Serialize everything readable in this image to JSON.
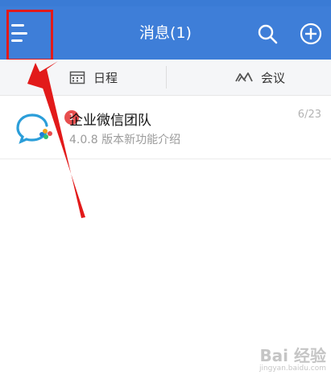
{
  "app_bar": {
    "title": "消息(1)",
    "icons": {
      "menu": "menu-icon",
      "search": "search-icon",
      "add": "add-circle-icon"
    }
  },
  "tabs": [
    {
      "label": "日程",
      "icon": "calendar-icon"
    },
    {
      "label": "会议",
      "icon": "meeting-icon"
    }
  ],
  "messages": [
    {
      "title": "企业微信团队",
      "subtitle": "4.0.8 版本新功能介绍",
      "date": "6/23",
      "badge": "1",
      "icon": "wecom-logo-icon"
    }
  ],
  "watermark": {
    "text": "Bai 经验",
    "url_text": "jingyan.baidu.com"
  },
  "colors": {
    "app_bar": "#3e7ed8",
    "highlight": "#e21a1a",
    "badge": "#e84e4e"
  }
}
